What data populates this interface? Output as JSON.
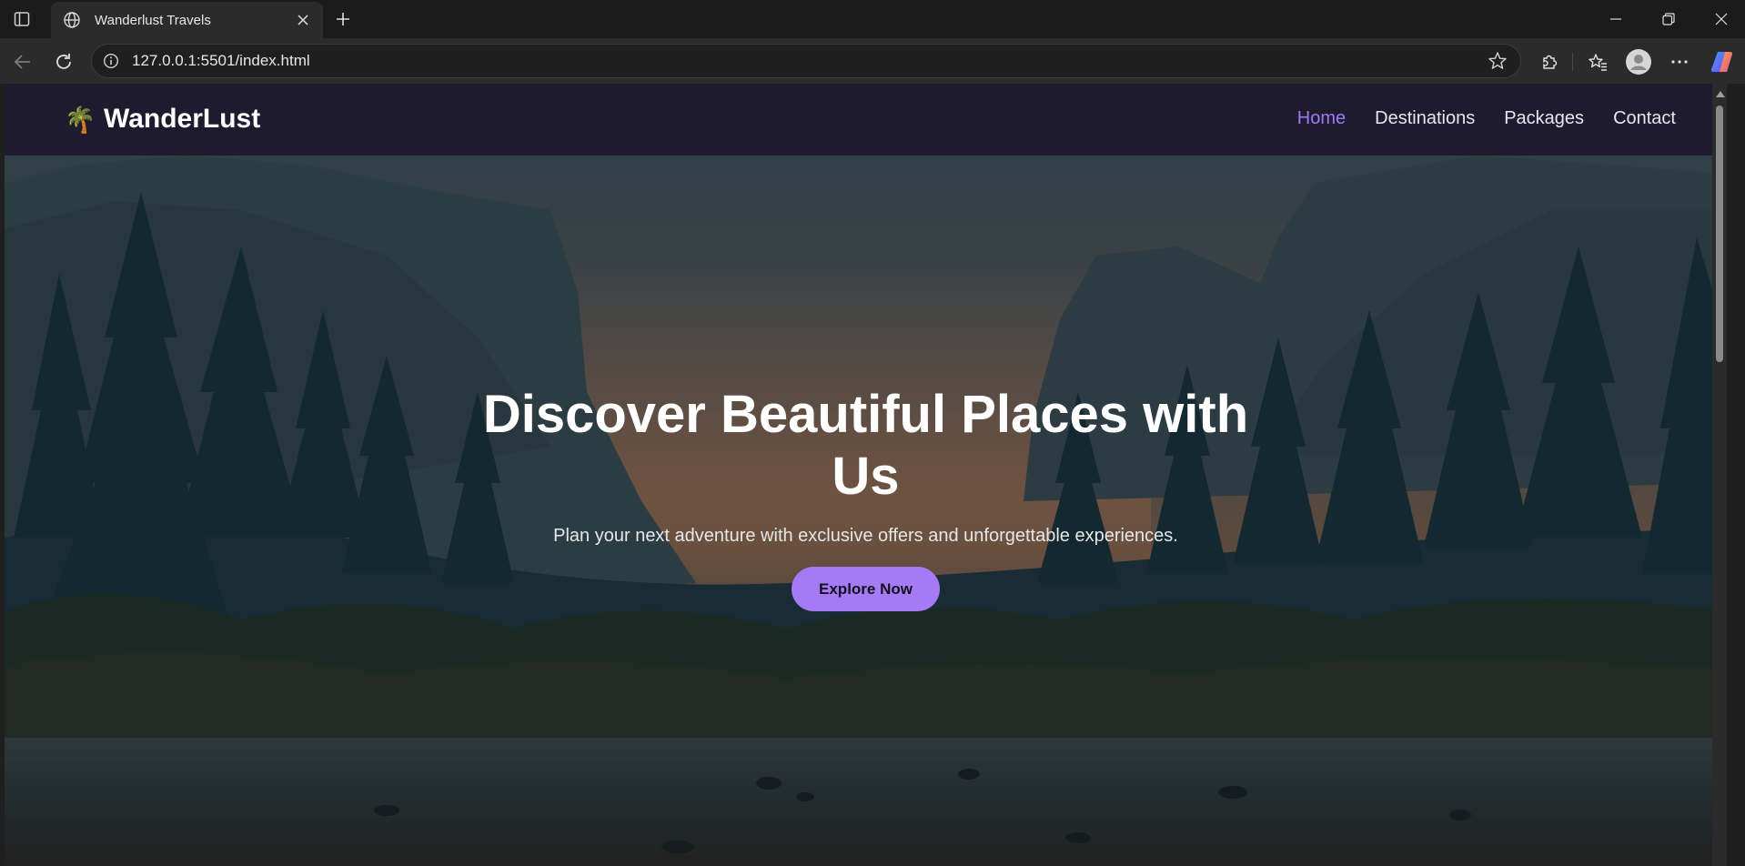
{
  "browser": {
    "tab_title": "Wanderlust Travels",
    "url": "127.0.0.1:5501/index.html",
    "icons": [
      "sidebar-toggle-icon",
      "globe-icon",
      "close-icon",
      "plus-icon",
      "minimize-icon",
      "restore-icon",
      "close-window-icon",
      "back-icon",
      "reload-icon",
      "site-info-icon",
      "star-icon",
      "extensions-icon",
      "favorites-icon",
      "profile-icon",
      "more-icon",
      "copilot-icon"
    ]
  },
  "site": {
    "logo_emoji": "🌴",
    "logo_text": "WanderLust",
    "nav": [
      {
        "label": "Home",
        "active": true
      },
      {
        "label": "Destinations",
        "active": false
      },
      {
        "label": "Packages",
        "active": false
      },
      {
        "label": "Contact",
        "active": false
      }
    ],
    "hero": {
      "title": "Discover Beautiful Places with Us",
      "subtitle": "Plan your next adventure with exclusive offers and unforgettable experiences.",
      "cta_label": "Explore Now"
    }
  },
  "colors": {
    "nav_bg": "#1e1b2e",
    "accent": "#9b7cf5",
    "cta_bg": "#a47bf5"
  }
}
